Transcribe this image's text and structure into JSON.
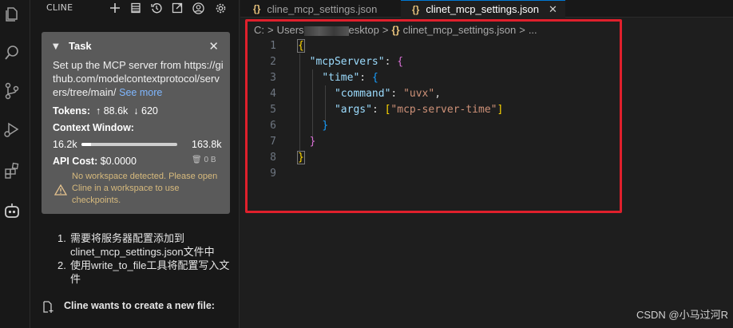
{
  "sidebar": {
    "title": "CLINE",
    "toolbar": [
      "plus-icon",
      "history-list-icon",
      "history-icon",
      "popout-icon",
      "account-icon",
      "gear-icon"
    ]
  },
  "activity_bar": [
    "explorer-icon",
    "search-icon",
    "source-control-icon",
    "run-debug-icon",
    "extensions-icon",
    "cline-robot-icon"
  ],
  "task": {
    "heading": "Task",
    "text": "Set up the MCP server from https://github.com/modelcontextprotocol/servers/tree/main/",
    "see_more": "See more",
    "tokens_label": "Tokens:",
    "tokens_up": "88.6k",
    "tokens_down": "620",
    "context_label": "Context Window:",
    "context_used": "16.2k",
    "context_max": "163.8k",
    "context_fraction": 0.099,
    "api_cost_label": "API Cost:",
    "api_cost_value": "$0.0000",
    "storage": "0 B",
    "warning": "No workspace detected. Please open Cline in a workspace to use checkpoints."
  },
  "steps": [
    {
      "num": "1.",
      "text": "需要将服务器配置添加到clinet_mcp_settings.json文件中"
    },
    {
      "num": "2.",
      "text": "使用write_to_file工具将配置写入文件"
    }
  ],
  "create_file_text": "Cline wants to create a new file:",
  "tabs": [
    {
      "label": "cline_mcp_settings.json",
      "active": false
    },
    {
      "label": "clinet_mcp_settings.json",
      "active": true
    }
  ],
  "breadcrumb": {
    "drive": "C:",
    "users": "Users",
    "desktop": "esktop",
    "file": "clinet_mcp_settings.json",
    "more": "..."
  },
  "code": {
    "line_numbers": [
      "1",
      "2",
      "3",
      "4",
      "5",
      "6",
      "7",
      "8",
      "9"
    ],
    "key_mcpServers": "\"mcpServers\"",
    "key_time": "\"time\"",
    "key_command": "\"command\"",
    "val_command": "\"uvx\"",
    "key_args": "\"args\"",
    "val_args": "\"mcp-server-time\""
  },
  "watermark": "CSDN @小马过河R"
}
